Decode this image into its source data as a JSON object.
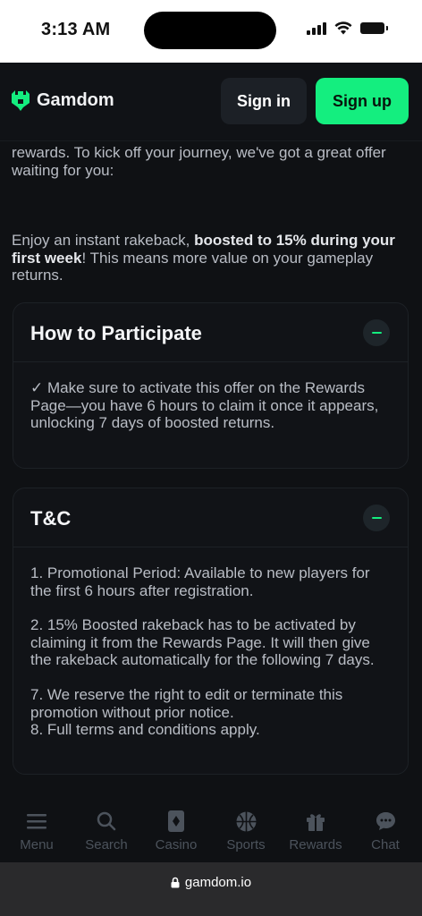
{
  "status_bar": {
    "time": "3:13 AM"
  },
  "header": {
    "logo_text": "Gamdom",
    "signin_label": "Sign in",
    "signup_label": "Sign up"
  },
  "intro": {
    "text": "rewards. To kick off your journey, we've got a great offer waiting for you:"
  },
  "offer": {
    "prefix": "Enjoy an instant rakeback, ",
    "bold": "boosted to 15% during your first week",
    "suffix": "! This means more value on your gameplay returns."
  },
  "how_to": {
    "title": "How to Participate",
    "body": "✓ Make sure to activate this offer on the Rewards Page—you have 6 hours to claim it once it appears, unlocking 7 days of boosted returns."
  },
  "tnc": {
    "title": "T&C",
    "items": [
      "1. Promotional Period: Available to new players for the first 6 hours after registration.",
      "2. 15% Boosted rakeback has to be activated by claiming it from the Rewards Page. It will then give the rakeback automatically for the following 7 days.",
      "7. We reserve the right to edit or terminate this promotion without prior notice.",
      "8. Full terms and conditions apply."
    ]
  },
  "nav": [
    {
      "label": "Menu",
      "icon": "menu-icon"
    },
    {
      "label": "Search",
      "icon": "search-icon"
    },
    {
      "label": "Casino",
      "icon": "casino-icon"
    },
    {
      "label": "Sports",
      "icon": "sports-icon"
    },
    {
      "label": "Rewards",
      "icon": "gift-icon"
    },
    {
      "label": "Chat",
      "icon": "chat-icon"
    }
  ],
  "browser": {
    "url": "gamdom.io"
  },
  "colors": {
    "accent": "#14ee7f",
    "background": "#0f1114",
    "card": "#111317",
    "muted_nav": "#4c535c"
  }
}
